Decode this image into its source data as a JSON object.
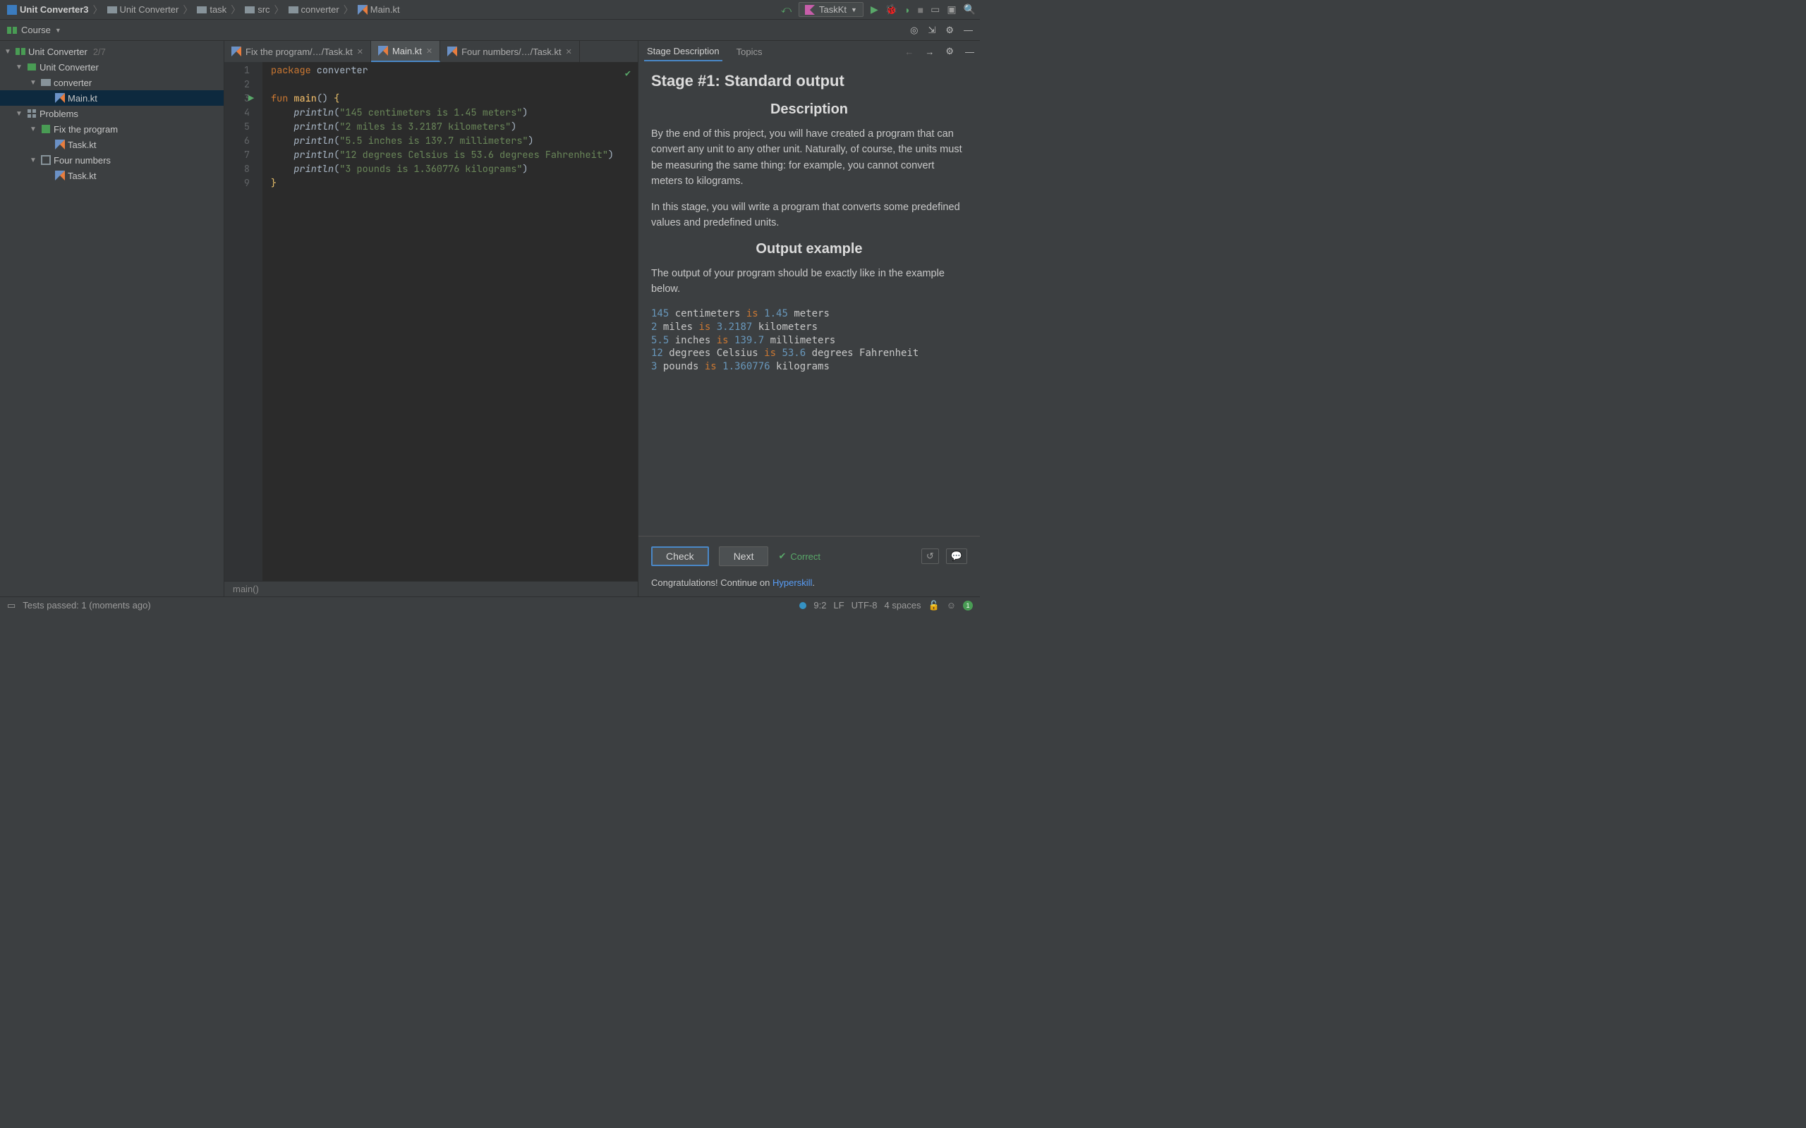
{
  "breadcrumb": [
    {
      "label": "Unit Converter3",
      "icon": "kt-project",
      "bold": true
    },
    {
      "label": "Unit Converter",
      "icon": "folder"
    },
    {
      "label": "task",
      "icon": "folder"
    },
    {
      "label": "src",
      "icon": "folder"
    },
    {
      "label": "converter",
      "icon": "folder"
    },
    {
      "label": "Main.kt",
      "icon": "kt"
    }
  ],
  "run_config": "TaskKt",
  "course_label": "Course",
  "tree": {
    "root": {
      "label": "Unit Converter",
      "count": "2/7"
    },
    "section": {
      "label": "Unit Converter"
    },
    "pkg": {
      "label": "converter"
    },
    "file_main": {
      "label": "Main.kt"
    },
    "problems": {
      "label": "Problems"
    },
    "prob1": {
      "label": "Fix the program"
    },
    "prob1_file": {
      "label": "Task.kt"
    },
    "prob2": {
      "label": "Four numbers"
    },
    "prob2_file": {
      "label": "Task.kt"
    }
  },
  "tabs": [
    {
      "label": "Fix the program/…/Task.kt",
      "active": false
    },
    {
      "label": "Main.kt",
      "active": true
    },
    {
      "label": "Four numbers/…/Task.kt",
      "active": false
    }
  ],
  "code": {
    "pkg_kw": "package",
    "pkg_name": " converter",
    "fun_kw": "fun ",
    "main_name": "main",
    "main_paren": "() ",
    "l_brace": "{",
    "r_brace": "}",
    "println": "println",
    "s1": "\"145 centimeters is 1.45 meters\"",
    "s2": "\"2 miles is 3.2187 kilometers\"",
    "s3": "\"5.5 inches is 139.7 millimeters\"",
    "s4": "\"12 degrees Celsius is 53.6 degrees Fahrenheit\"",
    "s5": "\"3 pounds is 1.360776 kilograms\"",
    "lines": [
      "1",
      "2",
      "3",
      "4",
      "5",
      "6",
      "7",
      "8",
      "9"
    ]
  },
  "editor_footer": "main()",
  "right_tabs": {
    "desc": "Stage Description",
    "topics": "Topics"
  },
  "task": {
    "title": "Stage #1: Standard output",
    "h_desc": "Description",
    "p1": "By the end of this project, you will have created a program that can convert any unit to any other unit. Naturally, of course, the units must be measuring the same thing: for example, you cannot convert meters to kilograms.",
    "p2": "In this stage, you will write a program that converts some predefined values and predefined units.",
    "h_out": "Output example",
    "p3": "The output of your program should be exactly like in the example below.",
    "example": [
      {
        "n": "145",
        "t": " centimeters ",
        "k": "is",
        "n2": " 1.45",
        "t2": " meters"
      },
      {
        "n": "2",
        "t": " miles ",
        "k": "is",
        "n2": " 3.2187",
        "t2": " kilometers"
      },
      {
        "n": "5.5",
        "t": " inches ",
        "k": "is",
        "n2": " 139.7",
        "t2": " millimeters"
      },
      {
        "n": "12",
        "t": " degrees Celsius ",
        "k": "is",
        "n2": " 53.6",
        "t2": " degrees Fahrenheit"
      },
      {
        "n": "3",
        "t": " pounds ",
        "k": "is",
        "n2": " 1.360776",
        "t2": " kilograms"
      }
    ]
  },
  "check_btn": "Check",
  "next_btn": "Next",
  "correct": "Correct",
  "congrats_pre": "Congratulations! Continue on ",
  "congrats_link": "Hyperskill",
  "status": {
    "tests": "Tests passed: 1 (moments ago)",
    "pos": "9:2",
    "lf": "LF",
    "enc": "UTF-8",
    "indent": "4 spaces",
    "badge": "1"
  }
}
